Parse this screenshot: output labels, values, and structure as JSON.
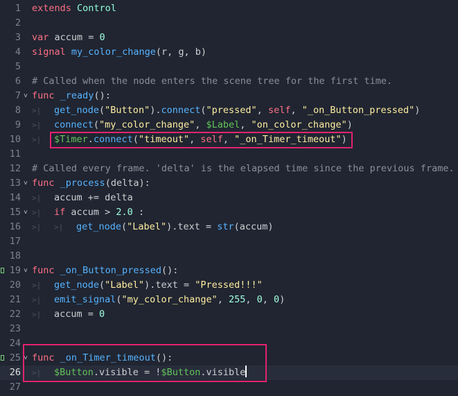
{
  "colors": {
    "background": "#202531",
    "keyword": "#ff7085",
    "string": "#ffeda1",
    "number": "#a1ffe0",
    "function": "#57b3ff",
    "node_path": "#63c259",
    "comment": "#8a8f9a",
    "highlight_box": "#e3236e"
  },
  "editor": {
    "current_line": 26,
    "lines": [
      {
        "n": "1",
        "t": [
          {
            "c": "kw",
            "s": "extends"
          },
          {
            "c": "txt",
            "s": " "
          },
          {
            "c": "cls",
            "s": "Control"
          }
        ]
      },
      {
        "n": "2",
        "t": []
      },
      {
        "n": "3",
        "t": [
          {
            "c": "kw",
            "s": "var"
          },
          {
            "c": "txt",
            "s": " accum = "
          },
          {
            "c": "num",
            "s": "0"
          }
        ]
      },
      {
        "n": "4",
        "t": [
          {
            "c": "kw",
            "s": "signal"
          },
          {
            "c": "txt",
            "s": " "
          },
          {
            "c": "fn",
            "s": "my_color_change"
          },
          {
            "c": "txt",
            "s": "(r, g, b)"
          }
        ]
      },
      {
        "n": "5",
        "t": []
      },
      {
        "n": "6",
        "t": [
          {
            "c": "cmt",
            "s": "# Called when the node enters the scene tree for the first time."
          }
        ]
      },
      {
        "n": "7",
        "fold": true,
        "t": [
          {
            "c": "kw",
            "s": "func"
          },
          {
            "c": "txt",
            "s": " "
          },
          {
            "c": "fn",
            "s": "_ready"
          },
          {
            "c": "txt",
            "s": "():"
          }
        ]
      },
      {
        "n": "8",
        "tabs": 1,
        "t": [
          {
            "c": "fn",
            "s": "get_node"
          },
          {
            "c": "txt",
            "s": "("
          },
          {
            "c": "str",
            "s": "\"Button\""
          },
          {
            "c": "txt",
            "s": ")."
          },
          {
            "c": "fn",
            "s": "connect"
          },
          {
            "c": "txt",
            "s": "("
          },
          {
            "c": "str",
            "s": "\"pressed\""
          },
          {
            "c": "txt",
            "s": ", "
          },
          {
            "c": "kw",
            "s": "self"
          },
          {
            "c": "txt",
            "s": ", "
          },
          {
            "c": "str",
            "s": "\"_on_Button_pressed\""
          },
          {
            "c": "txt",
            "s": ")"
          }
        ]
      },
      {
        "n": "9",
        "tabs": 1,
        "t": [
          {
            "c": "fn",
            "s": "connect"
          },
          {
            "c": "txt",
            "s": "("
          },
          {
            "c": "str",
            "s": "\"my_color_change\""
          },
          {
            "c": "txt",
            "s": ", "
          },
          {
            "c": "node",
            "s": "$Label"
          },
          {
            "c": "txt",
            "s": ", "
          },
          {
            "c": "str",
            "s": "\"on_color_change\""
          },
          {
            "c": "txt",
            "s": ")"
          }
        ]
      },
      {
        "n": "10",
        "tabs": 1,
        "t": [
          {
            "c": "node",
            "s": "$Timer"
          },
          {
            "c": "txt",
            "s": "."
          },
          {
            "c": "fn",
            "s": "connect"
          },
          {
            "c": "txt",
            "s": "("
          },
          {
            "c": "str",
            "s": "\"timeout\""
          },
          {
            "c": "txt",
            "s": ", "
          },
          {
            "c": "kw",
            "s": "self"
          },
          {
            "c": "txt",
            "s": ", "
          },
          {
            "c": "str",
            "s": "\"_on_Timer_timeout\""
          },
          {
            "c": "txt",
            "s": ")"
          }
        ]
      },
      {
        "n": "11",
        "t": []
      },
      {
        "n": "12",
        "t": [
          {
            "c": "cmt",
            "s": "# Called every frame. 'delta' is the elapsed time since the previous frame."
          }
        ]
      },
      {
        "n": "13",
        "fold": true,
        "t": [
          {
            "c": "kw",
            "s": "func"
          },
          {
            "c": "txt",
            "s": " "
          },
          {
            "c": "fn",
            "s": "_process"
          },
          {
            "c": "txt",
            "s": "(delta):"
          }
        ]
      },
      {
        "n": "14",
        "tabs": 1,
        "t": [
          {
            "c": "txt",
            "s": "accum += delta"
          }
        ]
      },
      {
        "n": "15",
        "tabs": 1,
        "fold": true,
        "t": [
          {
            "c": "kw",
            "s": "if"
          },
          {
            "c": "txt",
            "s": " accum > "
          },
          {
            "c": "num",
            "s": "2.0"
          },
          {
            "c": "txt",
            "s": " :"
          }
        ]
      },
      {
        "n": "16",
        "tabs": 2,
        "t": [
          {
            "c": "fn",
            "s": "get_node"
          },
          {
            "c": "txt",
            "s": "("
          },
          {
            "c": "str",
            "s": "\"Label\""
          },
          {
            "c": "txt",
            "s": ").text = "
          },
          {
            "c": "fn",
            "s": "str"
          },
          {
            "c": "txt",
            "s": "(accum)"
          }
        ]
      },
      {
        "n": "17",
        "t": []
      },
      {
        "n": "18",
        "t": []
      },
      {
        "n": "19",
        "bookmark": true,
        "fold": true,
        "t": [
          {
            "c": "kw",
            "s": "func"
          },
          {
            "c": "txt",
            "s": " "
          },
          {
            "c": "fn",
            "s": "_on_Button_pressed"
          },
          {
            "c": "txt",
            "s": "():"
          }
        ]
      },
      {
        "n": "20",
        "tabs": 1,
        "t": [
          {
            "c": "fn",
            "s": "get_node"
          },
          {
            "c": "txt",
            "s": "("
          },
          {
            "c": "str",
            "s": "\"Label\""
          },
          {
            "c": "txt",
            "s": ").text = "
          },
          {
            "c": "str",
            "s": "\"Pressed!!!\""
          }
        ]
      },
      {
        "n": "21",
        "tabs": 1,
        "t": [
          {
            "c": "fn",
            "s": "emit_signal"
          },
          {
            "c": "txt",
            "s": "("
          },
          {
            "c": "str",
            "s": "\"my_color_change\""
          },
          {
            "c": "txt",
            "s": ", "
          },
          {
            "c": "num",
            "s": "255"
          },
          {
            "c": "txt",
            "s": ", "
          },
          {
            "c": "num",
            "s": "0"
          },
          {
            "c": "txt",
            "s": ", "
          },
          {
            "c": "num",
            "s": "0"
          },
          {
            "c": "txt",
            "s": ")"
          }
        ]
      },
      {
        "n": "22",
        "tabs": 1,
        "t": [
          {
            "c": "txt",
            "s": "accum = "
          },
          {
            "c": "num",
            "s": "0"
          }
        ]
      },
      {
        "n": "23",
        "t": []
      },
      {
        "n": "24",
        "t": []
      },
      {
        "n": "25",
        "bookmark": true,
        "fold": true,
        "t": [
          {
            "c": "kw",
            "s": "func"
          },
          {
            "c": "txt",
            "s": " "
          },
          {
            "c": "fn",
            "s": "_on_Timer_timeout"
          },
          {
            "c": "txt",
            "s": "():"
          }
        ]
      },
      {
        "n": "26",
        "tabs": 1,
        "cursor": true,
        "t": [
          {
            "c": "node",
            "s": "$Button"
          },
          {
            "c": "txt",
            "s": ".visible = !"
          },
          {
            "c": "node",
            "s": "$Button"
          },
          {
            "c": "txt",
            "s": ".visible"
          }
        ]
      },
      {
        "n": "27",
        "t": []
      }
    ]
  }
}
